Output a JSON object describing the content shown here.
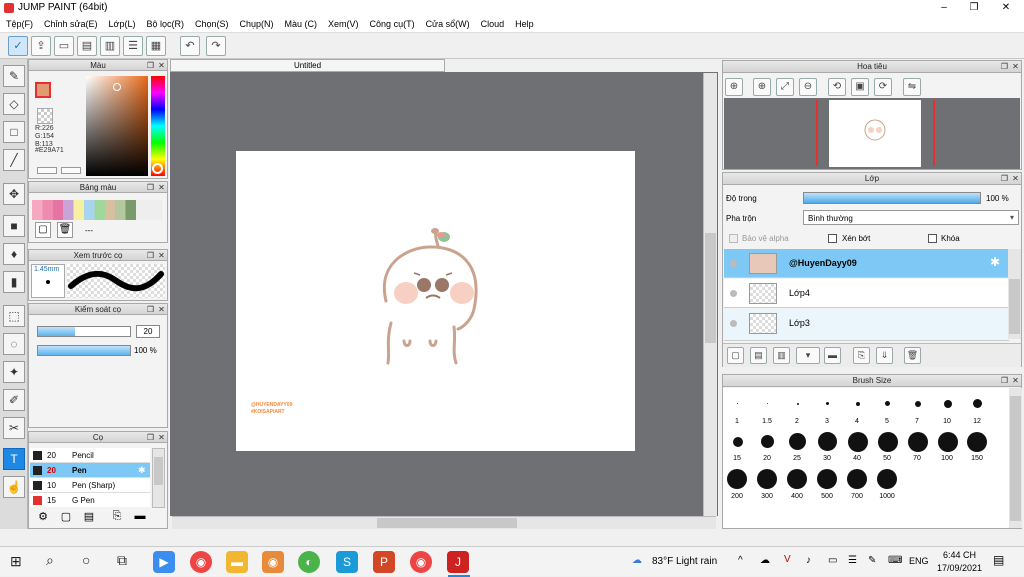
{
  "window": {
    "title": "JUMP PAINT (64bit)",
    "min": "–",
    "max": "❐",
    "close": "✕"
  },
  "menu": [
    "Tệp(F)",
    "Chỉnh sửa(E)",
    "Lớp(L)",
    "Bộ lọc(R)",
    "Chọn(S)",
    "Chụp(N)",
    "Màu (C)",
    "Xem(V)",
    "Công cụ(T)",
    "Cửa sổ(W)",
    "Cloud",
    "Help"
  ],
  "color_panel": {
    "title": "Màu",
    "r": "R:226",
    "g": "G:154",
    "b": "B:113",
    "hex": "#E29A71",
    "fg": "#e29a71"
  },
  "swatch_panel": {
    "title": "Bảng màu",
    "label": "---"
  },
  "brush_preview": {
    "title": "Xem trước cọ",
    "size": "1.45mm"
  },
  "brush_control": {
    "title": "Kiểm soát cọ",
    "size": "20",
    "opacity": "100 %",
    "size_fill": 0.4,
    "opacity_fill": 1.0
  },
  "brush_list": {
    "title": "Cọ",
    "items": [
      {
        "size": "20",
        "name": "Pencil"
      },
      {
        "size": "20",
        "name": "Pen"
      },
      {
        "size": "10",
        "name": "Pen (Sharp)"
      },
      {
        "size": "15",
        "name": "G Pen"
      }
    ]
  },
  "document": {
    "tab": "Untitled",
    "watermark1": "@HUYENDAYY09",
    "watermark2": "#KOISAPIART"
  },
  "navigator": {
    "title": "Hoa tiêu"
  },
  "layer_panel": {
    "title": "Lớp",
    "opacity_label": "Độ trong",
    "opacity_value": "100 %",
    "blend_label": "Pha trộn",
    "blend_value": "Bình thường",
    "protect_alpha": "Bảo vệ alpha",
    "clipping": "Xén bớt",
    "lock": "Khóa",
    "layers": [
      "@HuyenDayy09",
      "Lớp4",
      "Lớp3"
    ]
  },
  "brush_size": {
    "title": "Brush Size",
    "row1": [
      "1",
      "1.5",
      "2",
      "3",
      "4",
      "5",
      "7",
      "10",
      "12"
    ],
    "row2": [
      "15",
      "20",
      "25",
      "30",
      "40",
      "50",
      "70",
      "100",
      "150"
    ],
    "row3": [
      "200",
      "300",
      "400",
      "500",
      "700",
      "1000"
    ]
  },
  "taskbar": {
    "weather": "83°F  Light rain",
    "lang": "ENG",
    "time": "6:44 CH",
    "date": "17/09/2021"
  }
}
